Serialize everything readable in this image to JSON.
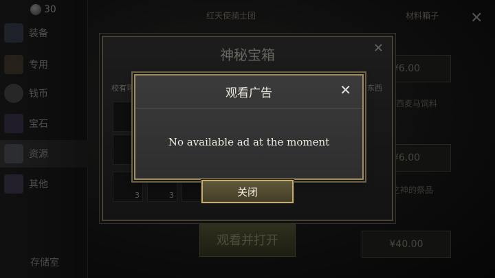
{
  "coins": {
    "count": "30"
  },
  "sidebar": {
    "items": [
      {
        "label": "装备"
      },
      {
        "label": "专用"
      },
      {
        "label": "钱币"
      },
      {
        "label": "宝石"
      },
      {
        "label": "资源"
      },
      {
        "label": "其他"
      }
    ],
    "storage_label": "存储室"
  },
  "shop": {
    "column_titles": [
      "红天使骑士团",
      "材料箱子"
    ],
    "prices": [
      "¥6.00",
      "¥6.00",
      "¥40.00"
    ],
    "right_titles": [
      "西麦马饲料",
      "之神的祭品"
    ],
    "watch_open_button": "观看并打开"
  },
  "chest_dialog": {
    "title": "神秘宝箱",
    "subtext": "校有可",
    "subtext_right": "么东西",
    "slot_counts": [
      "3",
      "3",
      "3",
      "3"
    ]
  },
  "ad_dialog": {
    "title": "观看广告",
    "message": "No available ad at the moment",
    "ok_button": "关闭"
  },
  "colors": {
    "accent_gold": "#c4ad71",
    "dialog_bg": "#3b3b3b",
    "text_light": "#ede9df"
  }
}
